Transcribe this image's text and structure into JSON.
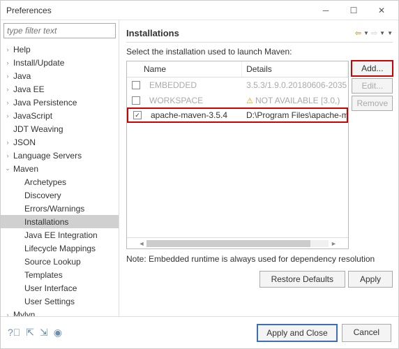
{
  "window": {
    "title": "Preferences"
  },
  "filter": {
    "placeholder": "type filter text"
  },
  "tree": {
    "items": [
      {
        "label": "Help",
        "level": 0,
        "exp": "›"
      },
      {
        "label": "Install/Update",
        "level": 0,
        "exp": "›"
      },
      {
        "label": "Java",
        "level": 0,
        "exp": "›"
      },
      {
        "label": "Java EE",
        "level": 0,
        "exp": "›"
      },
      {
        "label": "Java Persistence",
        "level": 0,
        "exp": "›"
      },
      {
        "label": "JavaScript",
        "level": 0,
        "exp": "›"
      },
      {
        "label": "JDT Weaving",
        "level": 0,
        "exp": ""
      },
      {
        "label": "JSON",
        "level": 0,
        "exp": "›"
      },
      {
        "label": "Language Servers",
        "level": 0,
        "exp": "›"
      },
      {
        "label": "Maven",
        "level": 0,
        "exp": "⌄"
      },
      {
        "label": "Archetypes",
        "level": 1,
        "exp": ""
      },
      {
        "label": "Discovery",
        "level": 1,
        "exp": ""
      },
      {
        "label": "Errors/Warnings",
        "level": 1,
        "exp": ""
      },
      {
        "label": "Installations",
        "level": 1,
        "exp": "",
        "selected": true
      },
      {
        "label": "Java EE Integration",
        "level": 1,
        "exp": ""
      },
      {
        "label": "Lifecycle Mappings",
        "level": 1,
        "exp": ""
      },
      {
        "label": "Source Lookup",
        "level": 1,
        "exp": ""
      },
      {
        "label": "Templates",
        "level": 1,
        "exp": ""
      },
      {
        "label": "User Interface",
        "level": 1,
        "exp": ""
      },
      {
        "label": "User Settings",
        "level": 1,
        "exp": ""
      },
      {
        "label": "Mylyn",
        "level": 0,
        "exp": "›"
      }
    ]
  },
  "main": {
    "heading": "Installations",
    "instruction": "Select the installation used to launch Maven:",
    "columns": {
      "name": "Name",
      "details": "Details"
    },
    "rows": [
      {
        "checked": false,
        "name": "EMBEDDED",
        "details": "3.5.3/1.9.0.20180606-2035",
        "disabled": true,
        "warn": false
      },
      {
        "checked": false,
        "name": "WORKSPACE",
        "details": "NOT AVAILABLE [3.0,)",
        "disabled": true,
        "warn": true
      },
      {
        "checked": true,
        "name": "apache-maven-3.5.4",
        "details": "D:\\Program Files\\apache-ma",
        "disabled": false,
        "warn": false,
        "highlight": true
      }
    ],
    "buttons": {
      "add": "Add...",
      "edit": "Edit...",
      "remove": "Remove"
    },
    "note": "Note: Embedded runtime is always used for dependency resolution",
    "restore": "Restore Defaults",
    "apply": "Apply"
  },
  "footer": {
    "apply_close": "Apply and Close",
    "cancel": "Cancel"
  }
}
